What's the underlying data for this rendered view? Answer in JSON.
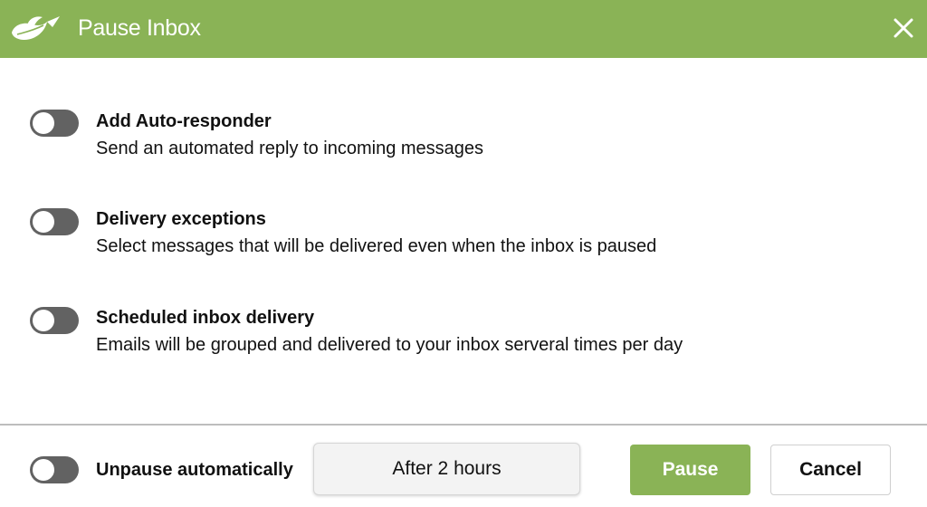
{
  "header": {
    "title": "Pause Inbox",
    "logo_icon": "sanebox-logo-icon",
    "close_icon": "close-icon",
    "background_color": "#8ab356"
  },
  "options": [
    {
      "title": "Add Auto-responder",
      "description": "Send an automated reply to incoming messages",
      "enabled": false
    },
    {
      "title": "Delivery exceptions",
      "description": "Select messages that will be delivered even when the inbox is paused",
      "enabled": false
    },
    {
      "title": "Scheduled inbox delivery",
      "description": "Emails will be grouped and delivered to your inbox serveral times per day",
      "enabled": false
    }
  ],
  "footer": {
    "unpause_label": "Unpause automatically",
    "unpause_enabled": false,
    "duration_value": "After 2 hours",
    "pause_label": "Pause",
    "cancel_label": "Cancel",
    "pause_color": "#8ab356"
  }
}
